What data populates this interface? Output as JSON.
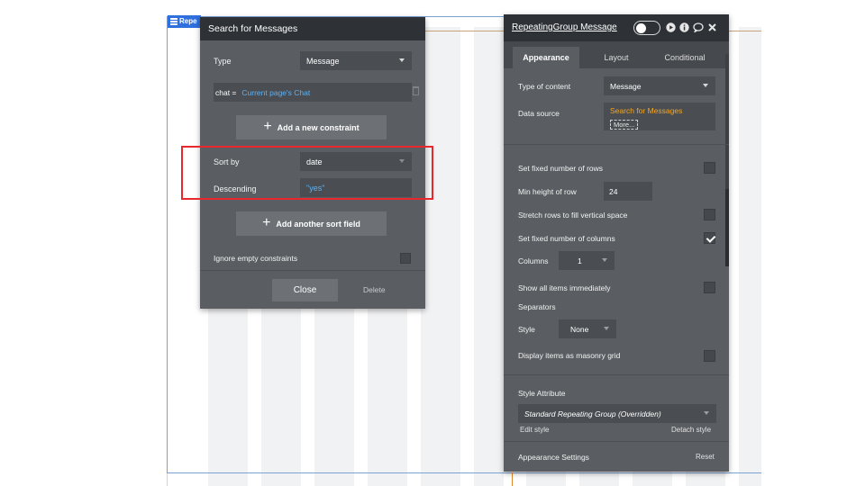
{
  "canvas": {
    "element_tag": "Repe"
  },
  "search_panel": {
    "title": "Search for Messages",
    "type_label": "Type",
    "type_value": "Message",
    "constraint_key": "chat =",
    "constraint_value": "Current page's Chat",
    "add_constraint_label": "Add a new constraint",
    "sort_by_label": "Sort by",
    "sort_by_value": "date",
    "descending_label": "Descending",
    "descending_value": "\"yes\"",
    "add_sort_label": "Add another sort field",
    "ignore_empty_label": "Ignore empty constraints",
    "close_label": "Close",
    "delete_label": "Delete"
  },
  "property_editor": {
    "title": "RepeatingGroup Message",
    "tabs": [
      "Appearance",
      "Layout",
      "Conditional"
    ],
    "active_tab": "Appearance",
    "type_of_content_label": "Type of content",
    "type_of_content_value": "Message",
    "data_source_label": "Data source",
    "data_source_value": "Search for Messages",
    "data_source_more": "More...",
    "fixed_rows_label": "Set fixed number of rows",
    "min_height_label": "Min height of row",
    "min_height_value": "24",
    "stretch_rows_label": "Stretch rows to fill vertical space",
    "fixed_columns_label": "Set fixed number of columns",
    "columns_label": "Columns",
    "columns_value": "1",
    "show_all_label": "Show all items immediately",
    "separators_label": "Separators",
    "style_label": "Style",
    "style_value": "None",
    "masonry_label": "Display items as masonry grid",
    "style_attribute_label": "Style Attribute",
    "style_attribute_value": "Standard Repeating Group (Overridden)",
    "edit_style_label": "Edit style",
    "detach_style_label": "Detach style",
    "appearance_settings_label": "Appearance Settings",
    "reset_label": "Reset"
  },
  "colors": {
    "panel_bg": "#5a5e62",
    "header_bg": "#2e3236",
    "link_blue": "#5fb0f2",
    "dynamic_orange": "#f5a623",
    "highlight_red": "#e8282d"
  }
}
